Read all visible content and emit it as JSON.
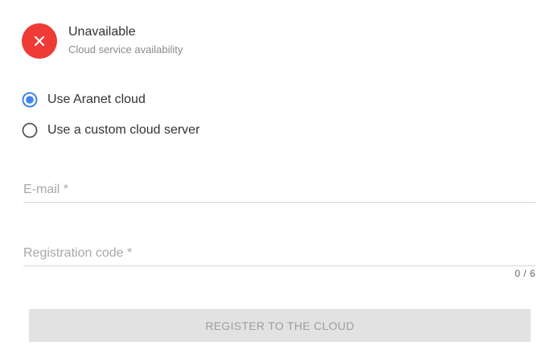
{
  "status": {
    "title": "Unavailable",
    "subtitle": "Cloud service availability",
    "icon": "close-icon",
    "color": "#ef3b36"
  },
  "cloud_options": {
    "selected": "aranet",
    "items": [
      {
        "id": "aranet",
        "label": "Use Aranet cloud",
        "checked": true
      },
      {
        "id": "custom",
        "label": "Use a custom cloud server",
        "checked": false
      }
    ]
  },
  "form": {
    "email": {
      "placeholder": "E-mail *",
      "value": ""
    },
    "registration_code": {
      "placeholder": "Registration code *",
      "value": "",
      "counter": "0 / 6"
    }
  },
  "register_button": {
    "label": "REGISTER TO THE CLOUD",
    "enabled": false
  },
  "colors": {
    "accent": "#3f84e8",
    "error": "#ef3b36",
    "disabled_bg": "#e2e2e2",
    "disabled_text": "#9e9e9e"
  }
}
